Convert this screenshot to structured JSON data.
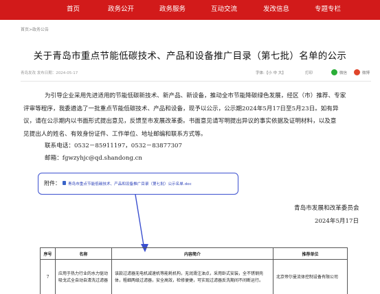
{
  "nav": {
    "items": [
      "首页",
      "政务公开",
      "政务服务",
      "互动交流",
      "发改信息",
      "专题专栏"
    ]
  },
  "breadcrumb": "首页>政务公告",
  "article": {
    "title": "关于青岛市重点节能低碳技术、产品和设备推广目录（第七批）名单的公示",
    "meta": "青岛发改 发布日期：2024-05-17",
    "font_tools": "字体:【小 中 大】",
    "print": "打印",
    "share_wechat": "微信",
    "share_weibo": "微博",
    "paragraph_lines": [
      "为引导企业采用先进适用的节能低碳新技术、新产品、新设备，推动全市节能降碳绿色发展，经区（市）推荐、专家",
      "评审等程序，我委遴选了一批重点节能低碳技术、产品和设备，现予以公示，公示期2024年5月17日至5月23日。如有异",
      "议，请在公示期内以书面形式提出意见，反馈至市发展改革委。书面意见请写明提出异议的事实依据及证明材料，以及意",
      "见提出人的姓名、有效身份证件、工作单位、地址邮编和联系方式等。"
    ],
    "phone": "联系电话：0532－85911197，0532－83877307",
    "email": "邮箱：fgwzyhjc@qd.shandong.cn",
    "attachment_label": "附件：",
    "attachment_link": "青岛市重点节能低碳技术、产品和设备推广目录（第七批）公示名单.doc",
    "signature_org": "青岛市发展和改革委员会",
    "signature_date": "2024年5月17日"
  },
  "table": {
    "headers": [
      "序号",
      "名称",
      "内容简介",
      "推荐单位"
    ],
    "row": {
      "no": "7",
      "name": "应用于热力行业的水力驱动吸戈式全自动自清洗过滤器",
      "intro": "该款过滤器无电机减速机等能耗机构，无润滑注油点，采用卧式安装，全不锈钢壳体，粗细两级过滤器，安全高效，检修便捷，可实现过滤器反洗期间不间断运行。",
      "unit": "北京帝尔曼流体控制设备有限公司"
    }
  },
  "colors": {
    "nav_red": "#d21a1a",
    "annotation_blue": "#3a4fcf"
  }
}
